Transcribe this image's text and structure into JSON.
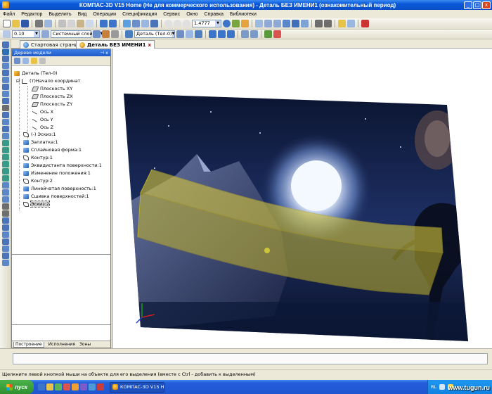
{
  "window": {
    "title": "КОМПАС-3D V15 Home (Не для коммерческого использования) - Деталь БЕЗ ИМЕНИ1 (ознакомительный период)",
    "buttons": [
      "_",
      "□",
      "x"
    ]
  },
  "menu": [
    "Файл",
    "Редактор",
    "Выделить",
    "Вид",
    "Операции",
    "Спецификация",
    "Сервис",
    "Окно",
    "Справка",
    "Библиотеки"
  ],
  "toolbar": {
    "zoom_value": "1.4777",
    "line_width": "0.10",
    "layer": "Системный слой (0)",
    "part_select": "Деталь (Тел-0)"
  },
  "tabs": [
    {
      "label": "Стартовая страница",
      "active": false
    },
    {
      "label": "Деталь БЕЗ ИМЕНИ1",
      "active": true,
      "close": "x"
    }
  ],
  "tree_panel": {
    "title": "Дерево модели",
    "pin": "⊣ x",
    "items": [
      {
        "label": "Деталь (Тел-0)",
        "icon": "root"
      },
      {
        "label": "(т)Начало координат",
        "icon": "origin"
      },
      {
        "label": "Плоскость XY",
        "icon": "plane"
      },
      {
        "label": "Плоскость ZX",
        "icon": "plane"
      },
      {
        "label": "Плоскость ZY",
        "icon": "plane"
      },
      {
        "label": "Ось X",
        "icon": "axis"
      },
      {
        "label": "Ось Y",
        "icon": "axis"
      },
      {
        "label": "Ось Z",
        "icon": "axis"
      },
      {
        "label": "(-) Эскиз:1",
        "icon": "sketch"
      },
      {
        "label": "Заплатка:1",
        "icon": "solid"
      },
      {
        "label": "Сплайновая форма:1",
        "icon": "solid"
      },
      {
        "label": "Контур:1",
        "icon": "sketch"
      },
      {
        "label": "Эквидистанта поверхности:1",
        "icon": "solid"
      },
      {
        "label": "Изменение положения:1",
        "icon": "solid"
      },
      {
        "label": "Контур:2",
        "icon": "sketch"
      },
      {
        "label": "Линейчатая поверхность:1",
        "icon": "solid"
      },
      {
        "label": "Сшивка поверхностей:1",
        "icon": "solid"
      },
      {
        "label": "Эскиз:2",
        "icon": "sketch",
        "selected": true
      }
    ],
    "bottom_tabs": [
      "Построение",
      "Исполнения",
      "Зоны"
    ]
  },
  "status_bar": {
    "hint": "Щелкните левой кнопкой мыши на объекте для его выделения (вместе с Ctrl - добавить к выделенным)"
  },
  "taskbar": {
    "start": "пуск",
    "task": "КОМПАС-3D V15 Ho...",
    "lang": "RL",
    "watermark": "www.tugun.ru"
  },
  "colors": {
    "accent": "#0a4fc7",
    "surface": "#d6c63a",
    "image_bg": "#0e1a35"
  }
}
